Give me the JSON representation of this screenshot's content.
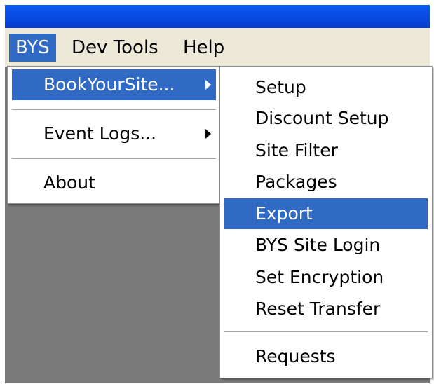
{
  "menubar": {
    "items": [
      {
        "label": "BYS"
      },
      {
        "label": "Dev Tools"
      },
      {
        "label": "Help"
      }
    ]
  },
  "bys_menu": {
    "items": [
      {
        "label": "BookYourSite...",
        "submenu": true
      },
      {
        "label": "Event Logs...",
        "submenu": true
      },
      {
        "label": "About",
        "submenu": false
      }
    ]
  },
  "bookyoursite_submenu": {
    "items": [
      {
        "label": "Setup"
      },
      {
        "label": "Discount Setup"
      },
      {
        "label": "Site Filter"
      },
      {
        "label": "Packages"
      },
      {
        "label": "Export"
      },
      {
        "label": "BYS Site Login"
      },
      {
        "label": "Set Encryption"
      },
      {
        "label": "Reset Transfer"
      },
      {
        "label": "Requests"
      }
    ],
    "highlighted": "Export"
  },
  "colors": {
    "highlight": "#316ac5",
    "menubar_bg": "#ece9d8",
    "titlebar": "#0a4fe6",
    "workspace": "#7a7a7a"
  }
}
